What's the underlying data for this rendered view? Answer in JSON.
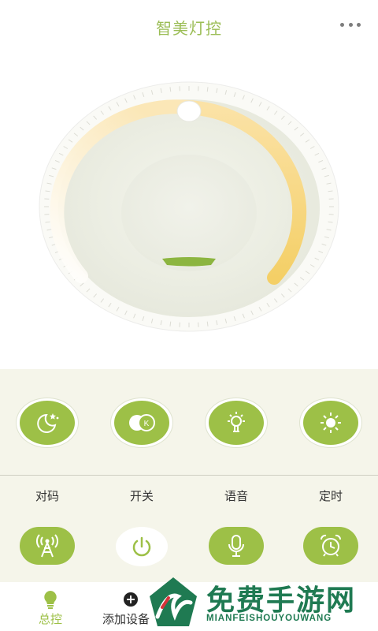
{
  "header": {
    "title": "智美灯控",
    "more_icon": "more-dots-icon"
  },
  "dial": {
    "level": 0.5,
    "icon": "brightness-dial-icon"
  },
  "colors": {
    "accent": "#9dc047",
    "title": "#9bbd55",
    "arc": "#f7d98b",
    "panel": "#f5f5ea"
  },
  "modes": [
    {
      "icon": "night-moon-icon"
    },
    {
      "icon": "toggle-k-icon"
    },
    {
      "icon": "bulb-icon"
    },
    {
      "icon": "sun-icon"
    }
  ],
  "functions": [
    {
      "label": "对码",
      "icon": "signal-tower-icon"
    },
    {
      "label": "开关",
      "icon": "power-icon"
    },
    {
      "label": "语音",
      "icon": "microphone-icon"
    },
    {
      "label": "定时",
      "icon": "alarm-clock-icon"
    }
  ],
  "tabbar": {
    "tabs": [
      {
        "label": "总控",
        "icon": "bulb-tab-icon",
        "active": true
      },
      {
        "label": "添加设备",
        "icon": "add-circle-icon",
        "active": false
      }
    ]
  },
  "watermark": {
    "title": "免费手游网",
    "subtitle": "MIANFEISHOUYOUWANG"
  }
}
